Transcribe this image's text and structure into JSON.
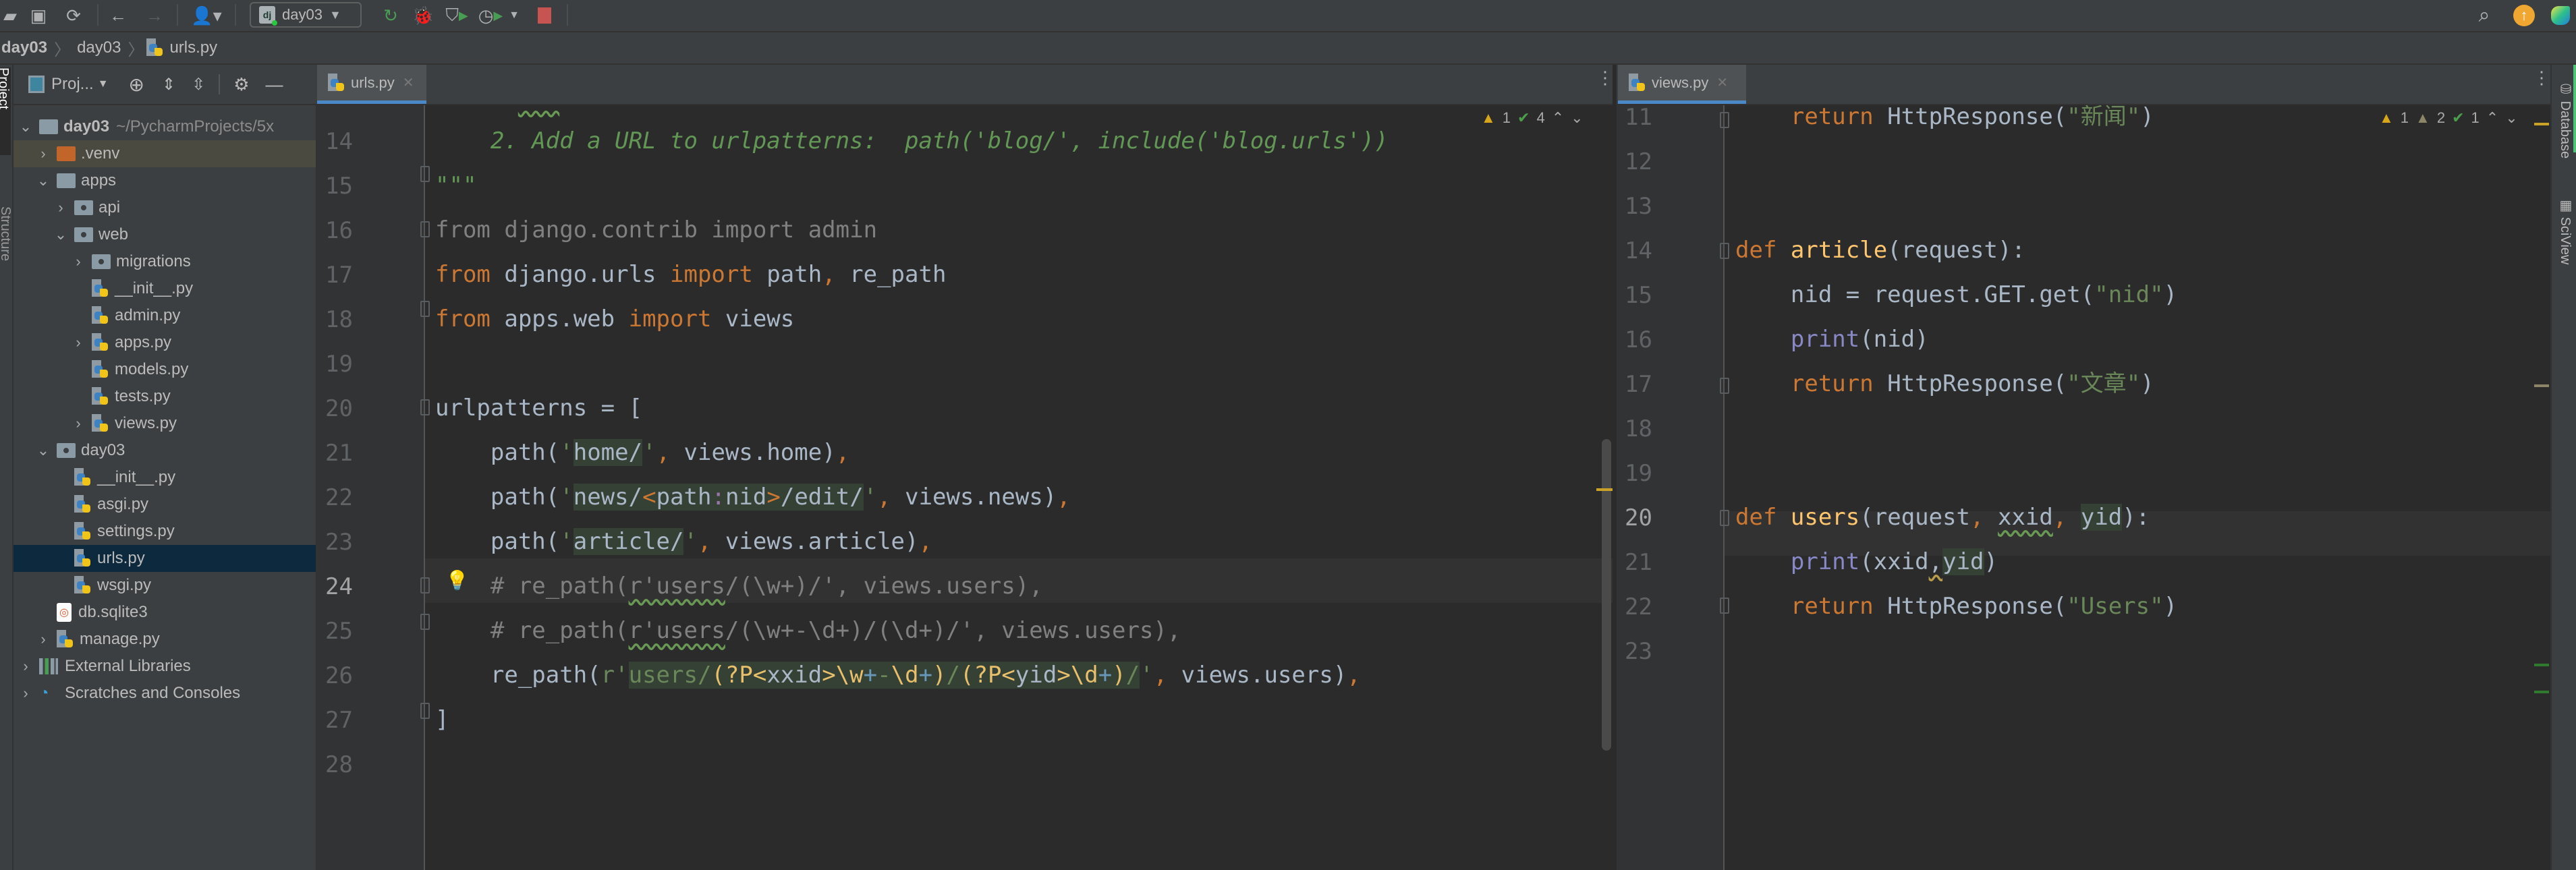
{
  "toolbar": {
    "run_config": "day03",
    "icons": [
      "open-folder-icon",
      "save-icon",
      "sync-icon",
      "back-icon",
      "forward-icon",
      "user-icon",
      "django-icon",
      "rerun-icon",
      "debug-icon",
      "coverage-icon",
      "profile-icon",
      "stop-icon",
      "search-icon",
      "update-icon",
      "toolbox-icon"
    ]
  },
  "breadcrumb": [
    "day03",
    "day03",
    "urls.py"
  ],
  "project_panel": {
    "title": "Proj...",
    "root": {
      "name": "day03",
      "path": "~/PycharmProjects/5x"
    },
    "items": [
      {
        "name": ".venv",
        "type": "folder-excluded",
        "depth": 1,
        "expand": "collapsed"
      },
      {
        "name": "apps",
        "type": "folder",
        "depth": 1,
        "expand": "expanded"
      },
      {
        "name": "api",
        "type": "package",
        "depth": 2,
        "expand": "collapsed"
      },
      {
        "name": "web",
        "type": "package",
        "depth": 2,
        "expand": "expanded"
      },
      {
        "name": "migrations",
        "type": "package",
        "depth": 3,
        "expand": "collapsed"
      },
      {
        "name": "__init__.py",
        "type": "python",
        "depth": 3,
        "expand": "none"
      },
      {
        "name": "admin.py",
        "type": "python",
        "depth": 3,
        "expand": "none"
      },
      {
        "name": "apps.py",
        "type": "python",
        "depth": 3,
        "expand": "collapsed"
      },
      {
        "name": "models.py",
        "type": "python",
        "depth": 3,
        "expand": "none"
      },
      {
        "name": "tests.py",
        "type": "python",
        "depth": 3,
        "expand": "none"
      },
      {
        "name": "views.py",
        "type": "python",
        "depth": 3,
        "expand": "collapsed"
      },
      {
        "name": "day03",
        "type": "package",
        "depth": 1,
        "expand": "expanded"
      },
      {
        "name": "__init__.py",
        "type": "python",
        "depth": 2,
        "expand": "none"
      },
      {
        "name": "asgi.py",
        "type": "python",
        "depth": 2,
        "expand": "none"
      },
      {
        "name": "settings.py",
        "type": "python",
        "depth": 2,
        "expand": "none"
      },
      {
        "name": "urls.py",
        "type": "python",
        "depth": 2,
        "expand": "none",
        "selected": true
      },
      {
        "name": "wsgi.py",
        "type": "python",
        "depth": 2,
        "expand": "none"
      },
      {
        "name": "db.sqlite3",
        "type": "sqlite",
        "depth": 1,
        "expand": "none"
      },
      {
        "name": "manage.py",
        "type": "python",
        "depth": 1,
        "expand": "collapsed"
      },
      {
        "name": "External Libraries",
        "type": "libraries",
        "depth": 0,
        "expand": "collapsed"
      },
      {
        "name": "Scratches and Consoles",
        "type": "scratches",
        "depth": 0,
        "expand": "collapsed"
      }
    ]
  },
  "side_tabs": {
    "left": [
      "Project",
      "Structure"
    ],
    "right": [
      "Database",
      "SciView"
    ]
  },
  "left_editor": {
    "tab": "urls.py",
    "inspections": {
      "warnings": "1",
      "typos": "4"
    },
    "current_line": "24",
    "lines": [
      {
        "n": "14",
        "text": "    2. Add a URL to urlpatterns:  path('blog/', include('blog.urls'))"
      },
      {
        "n": "15",
        "text": "\"\"\""
      },
      {
        "n": "16",
        "text": "from django.contrib import admin"
      },
      {
        "n": "17",
        "text": "from django.urls import path, re_path"
      },
      {
        "n": "18",
        "text": "from apps.web import views"
      },
      {
        "n": "19",
        "text": ""
      },
      {
        "n": "20",
        "text": "urlpatterns = ["
      },
      {
        "n": "21",
        "text": "    path('home/', views.home),"
      },
      {
        "n": "22",
        "text": "    path('news/<path:nid>/edit/', views.news),"
      },
      {
        "n": "23",
        "text": "    path('article/', views.article),"
      },
      {
        "n": "24",
        "text": "    # re_path(r'users/(\\w+)/', views.users),"
      },
      {
        "n": "25",
        "text": "    # re_path(r'users/(\\w+-\\d+)/(\\d+)/', views.users),"
      },
      {
        "n": "26",
        "text": "    re_path(r'users/(?P<xxid>\\w+-\\d+)/(?P<yid>\\d+)/', views.users),"
      },
      {
        "n": "27",
        "text": "]"
      },
      {
        "n": "28",
        "text": ""
      }
    ],
    "tokens": {
      "l14": "    2. Add a URL to urlpatterns:  path('blog/', include('blog.urls'))",
      "l15": "\"\"\"",
      "from": "from",
      "import": "import",
      "l16_mod": " django.contrib ",
      "l16_name": " admin",
      "l17_mod": " django.urls ",
      "l17_a": " path",
      "comma": ",",
      "l17_b": " re_path",
      "l18_mod": " apps.web ",
      "l18_name": " views",
      "l20": "urlpatterns = [",
      "path_open": "    path(",
      "q": "'",
      "l21_s": "home/",
      "l21_v": " views.home)",
      "l22_s1": "news/",
      "lt": "<",
      "l22_conv": "path",
      "colon": ":",
      "l22_nid": "nid",
      "gt": ">",
      "l22_s2": "/edit/",
      "l22_v": " views.news)",
      "l23_s": "article/",
      "l23_v": " views.article)",
      "l24_a": "    # re_path(",
      "l24_b": "r'users",
      "l24_c": "/(\\w+)/', views.users),",
      "l25_a": "    # re_path(",
      "l25_b": "r'users",
      "l25_c": "/(\\w+-\\d+)/(\\d+)/', views.users),",
      "l26_a": "    re_path(",
      "l26_r": "r'",
      "l26_users": "users/",
      "l26_g1": "(?P<",
      "l26_xxid": "xxid",
      "l26_g1e": ">",
      "l26_w": "\\w",
      "plus": "+",
      "dash": "-",
      "l26_d": "\\d",
      "rparen": ")",
      "slash": "/",
      "l26_yid": "yid",
      "l26_v": " views.users)",
      "l27": "]"
    }
  },
  "right_editor": {
    "tab": "views.py",
    "inspections": {
      "warnings": "1",
      "weak_warnings": "2",
      "typos": "1"
    },
    "current_line": "20",
    "lines": [
      {
        "n": "11",
        "text": "    return HttpResponse(\"新闻\")"
      },
      {
        "n": "12",
        "text": ""
      },
      {
        "n": "13",
        "text": ""
      },
      {
        "n": "14",
        "text": "def article(request):"
      },
      {
        "n": "15",
        "text": "    nid = request.GET.get(\"nid\")"
      },
      {
        "n": "16",
        "text": "    print(nid)"
      },
      {
        "n": "17",
        "text": "    return HttpResponse(\"文章\")"
      },
      {
        "n": "18",
        "text": ""
      },
      {
        "n": "19",
        "text": ""
      },
      {
        "n": "20",
        "text": "def users(request, xxid, yid):"
      },
      {
        "n": "21",
        "text": "    print(xxid,yid)"
      },
      {
        "n": "22",
        "text": "    return HttpResponse(\"Users\")"
      },
      {
        "n": "23",
        "text": ""
      }
    ],
    "tokens": {
      "ret": "return",
      "resp": " HttpResponse(",
      "close": ")",
      "s_news": "\"新闻\"",
      "s_article": "\"文章\"",
      "s_users": "\"Users\"",
      "s_nid": "\"nid\"",
      "def": "def",
      "fn_article": " article",
      "args_article": "(request):",
      "nid_assign": "    nid = request.GET.get(",
      "print": "print",
      "print_nid": "(nid)",
      "fn_users": " users",
      "u_open": "(request",
      "comma": ",",
      "xxid": "xxid",
      "yid": "yid",
      "u_close": "):",
      "p_open": "(xxid",
      "p_close": ")"
    }
  },
  "colors": {
    "keyword": "#cc7832",
    "string": "#6a8759",
    "docstring": "#629755",
    "function": "#ffc66d",
    "builtin": "#8888c6",
    "regex": "#e8bf6a",
    "comment": "#808080",
    "identifier": "#a9b7c6",
    "selection": "#0d293e",
    "stop": "#c75450",
    "run": "#499c54"
  }
}
